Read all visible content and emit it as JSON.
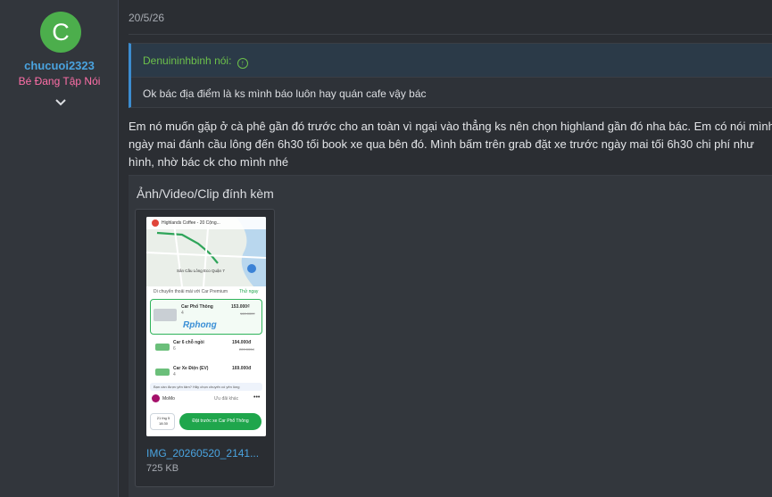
{
  "user": {
    "avatar_letter": "C",
    "avatar_color": "#4cae4c",
    "username": "chucuoi2323",
    "title": "Bé Đang Tập Nói",
    "expand_icon": "chevron-down-icon"
  },
  "post": {
    "date": "20/5/26",
    "quote": {
      "author_line": "Denuininhbinh nói:",
      "body": "Ok bác địa điểm là ks mình báo luôn hay quán cafe vậy bác"
    },
    "message_lines": [
      "Em nó muốn gặp ở cà phê gần đó trước cho an toàn vì ngại vào thẳng ks nên chọn highland gần đó nha bác. Em có nói mình",
      "ngày mai đánh cầu lông đến 6h30 tối book xe qua bên đó. Mình bấm trên grab đặt xe trước ngày mai tối 6h30 chi phí như",
      "hình, nhờ bác ck cho mình nhé"
    ],
    "attachments": {
      "title": "Ảnh/Video/Clip đính kèm",
      "file_name": "IMG_20260520_2141...",
      "file_size": "725 KB",
      "thumbnail": {
        "map_top_label": "Highlands Coffee - 20 Cộng...",
        "map_pin_label": "Sân Cầu Lông Eco Quận 7",
        "hint": "Di chuyển thoải mái với Car Premium",
        "hint_link": "Thử ngay",
        "options": [
          {
            "name": "Car Phổ Thông",
            "price": "153.000₫",
            "old_price": "160.000₫",
            "seats": "4"
          },
          {
            "name": "Car 6 chỗ ngồi",
            "price": "194.000đ",
            "old_price": "220.000đ",
            "seats": "6"
          },
          {
            "name": "Car Xe Điện (EV)",
            "price": "169.000đ",
            "seats": "4"
          }
        ],
        "safety_text": "Bạn cần được yên tâm? Hãy chọn chuyến có yên lòng",
        "payment": "MoMo",
        "payment_note": "Ưu đãi khác",
        "schedule": "21 thg 5 18:30",
        "book_button": "Đặt trước xe Car Phổ Thông",
        "watermark": "Rphong"
      }
    }
  }
}
